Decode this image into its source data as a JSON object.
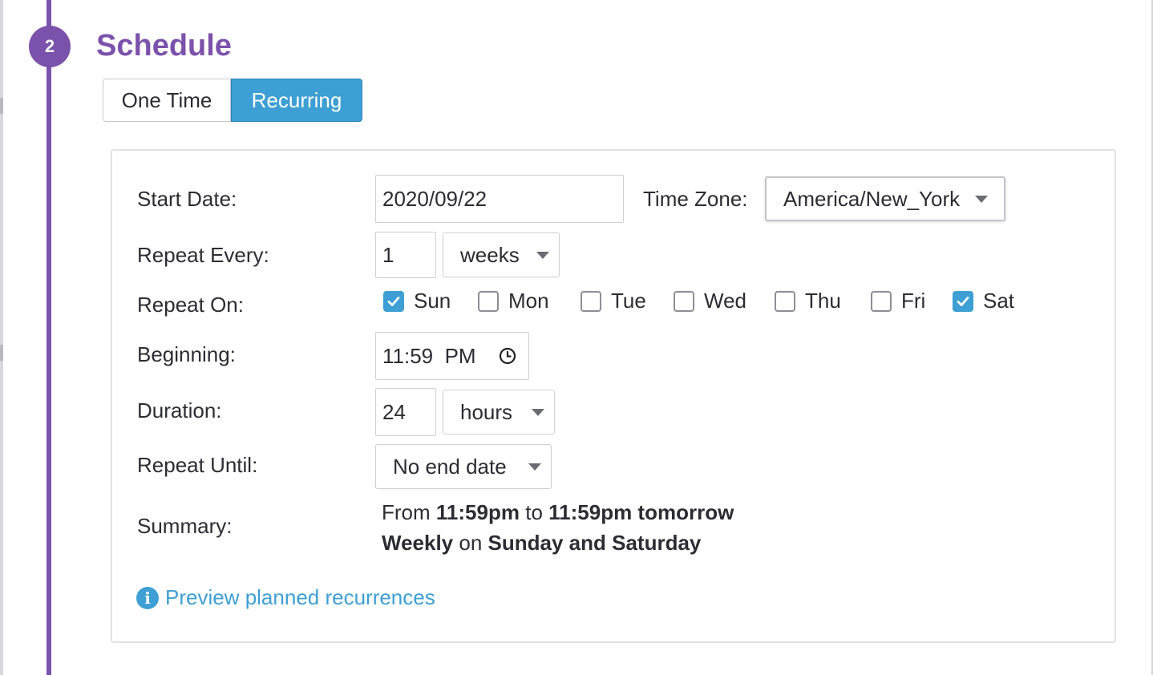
{
  "step": {
    "number": "2",
    "title": "Schedule"
  },
  "schedule_type": {
    "options": [
      "One Time",
      "Recurring"
    ],
    "selected": "Recurring"
  },
  "form": {
    "start_date": {
      "label": "Start Date:",
      "value": "2020/09/22"
    },
    "time_zone": {
      "label": "Time Zone:",
      "value": "America/New_York"
    },
    "repeat_every": {
      "label": "Repeat Every:",
      "value": "1",
      "unit": "weeks"
    },
    "repeat_on": {
      "label": "Repeat On:",
      "days": [
        {
          "label": "Sun",
          "checked": true
        },
        {
          "label": "Mon",
          "checked": false
        },
        {
          "label": "Tue",
          "checked": false
        },
        {
          "label": "Wed",
          "checked": false
        },
        {
          "label": "Thu",
          "checked": false
        },
        {
          "label": "Fri",
          "checked": false
        },
        {
          "label": "Sat",
          "checked": true
        }
      ]
    },
    "beginning": {
      "label": "Beginning:",
      "value": "11:59  PM"
    },
    "duration": {
      "label": "Duration:",
      "value": "24",
      "unit": "hours"
    },
    "repeat_until": {
      "label": "Repeat Until:",
      "value": "No end date"
    },
    "summary": {
      "label": "Summary:",
      "line1": {
        "prefix": "From",
        "start": "11:59pm",
        "mid": "to",
        "end": "11:59pm tomorrow"
      },
      "line2": {
        "frequency": "Weekly",
        "mid": "on",
        "days": "Sunday and Saturday"
      }
    }
  },
  "preview_link": "Preview planned recurrences",
  "colors": {
    "accent_purple": "#7b52ab",
    "accent_blue": "#3d9fd3"
  }
}
